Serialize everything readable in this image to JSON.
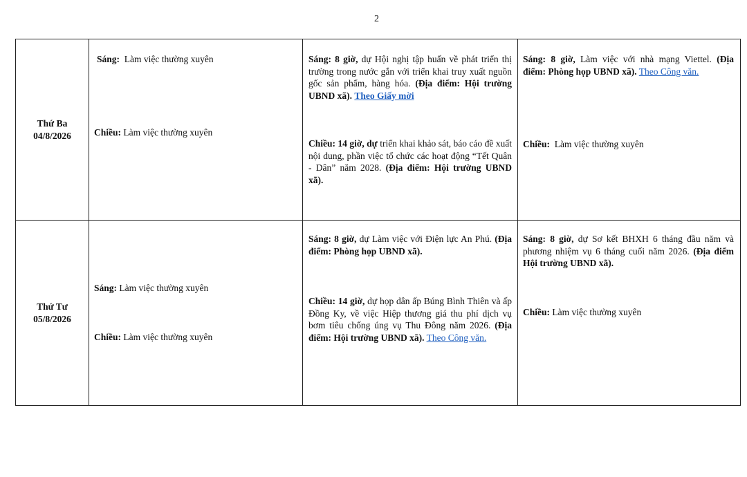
{
  "page_number": "2",
  "rows": [
    {
      "day": "Thứ Ba",
      "date": "04/8/2026",
      "col1": {
        "morning_label": "Sáng:",
        "morning_text": "Làm việc thường xuyên",
        "afternoon_label": "Chiều:",
        "afternoon_text": "Làm việc thường xuyên"
      },
      "col2": {
        "morning_label": "Sáng: 8 giờ,",
        "morning_text": " dự Hội nghị tập huấn về phát triển thị trường trong nước gắn với triển khai truy xuất nguồn gốc sản phẩm, hàng hóa. ",
        "morning_location": "(Địa điểm: Hội trường UBND xã).",
        "morning_link": "Theo Giấy mời",
        "afternoon_label": "Chiều: 14 giờ, dự",
        "afternoon_text": " triển khai khảo sát, báo cáo đề xuất nội dung, phần việc tổ chức các hoạt động “Tết Quân - Dân” năm 2028. ",
        "afternoon_location": "(Địa điểm: Hội trường UBND xã)."
      },
      "col3": {
        "morning_label": "Sáng: 8 giờ,",
        "morning_text": " Làm việc với nhà mạng Viettel. ",
        "morning_location": "(Địa điểm: Phòng họp UBND xã).",
        "morning_link": "Theo Công văn.",
        "afternoon_label": "Chiều:",
        "afternoon_text": "Làm việc thường xuyên"
      }
    },
    {
      "day": "Thứ Tư",
      "date": "05/8/2026",
      "col1": {
        "morning_label": "Sáng:",
        "morning_text": "Làm việc thường xuyên",
        "afternoon_label": "Chiều:",
        "afternoon_text": "Làm việc thường xuyên"
      },
      "col2": {
        "morning_label": "Sáng: 8 giờ,",
        "morning_text": " dự Làm việc với Điện lực An Phú. ",
        "morning_location": "(Địa điểm: Phòng họp UBND xã).",
        "afternoon_label": "Chiều: 14 giờ,",
        "afternoon_text": " dự họp dân ấp Búng Bình Thiên và ấp Đồng Ky, về việc Hiệp thương giá thu phí dịch vụ bơm tiêu chống úng vụ Thu Đông năm 2026. ",
        "afternoon_location": "(Địa điểm: Hội trường UBND xã).",
        "afternoon_link": "Theo Công văn."
      },
      "col3": {
        "morning_label": "Sáng: 8 giờ,",
        "morning_text": " dự Sơ kết BHXH 6 tháng đầu năm và phương nhiệm vụ 6 tháng cuối năm 2026. ",
        "morning_location": "(Địa điểm Hội trường UBND xã).",
        "afternoon_label": "Chiều:",
        "afternoon_text": "Làm việc thường xuyên"
      }
    }
  ]
}
